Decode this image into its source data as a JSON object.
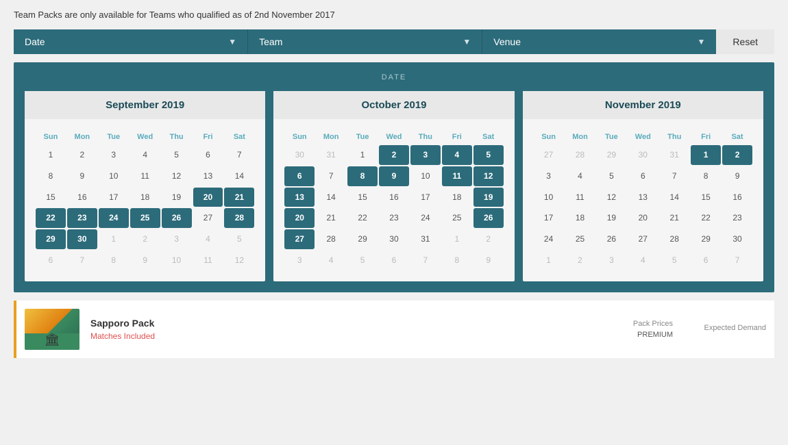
{
  "notice": "Team Packs are only available for Teams who qualified as of 2nd November 2017",
  "filters": {
    "date_label": "Date",
    "team_label": "Team",
    "venue_label": "Venue",
    "reset_label": "Reset"
  },
  "calendar_section": {
    "title": "DATE",
    "months": [
      {
        "name": "September 2019",
        "days_in_month": 30,
        "start_day": 0,
        "rows": [
          [
            "",
            "1",
            "2",
            "3",
            "4",
            "5",
            "6",
            "7"
          ],
          [
            "",
            "8",
            "9",
            "10",
            "11",
            "12",
            "13",
            "14"
          ],
          [
            "",
            "15",
            "16",
            "17",
            "18",
            "19",
            "20",
            "21"
          ],
          [
            "",
            "22",
            "23",
            "24",
            "25",
            "26",
            "27",
            "28"
          ],
          [
            "",
            "29",
            "30",
            "1",
            "2",
            "3",
            "4",
            "5"
          ],
          [
            "",
            "6",
            "7",
            "8",
            "9",
            "10",
            "11",
            "12"
          ]
        ],
        "highlighted": [
          "20",
          "21",
          "22",
          "23",
          "24",
          "25",
          "26",
          "28",
          "29",
          "30"
        ]
      },
      {
        "name": "October 2019",
        "rows": [
          [
            "30",
            "31",
            "1",
            "2",
            "3",
            "4",
            "5"
          ],
          [
            "6",
            "7",
            "8",
            "9",
            "10",
            "11",
            "12"
          ],
          [
            "13",
            "14",
            "15",
            "16",
            "17",
            "18",
            "19"
          ],
          [
            "20",
            "21",
            "22",
            "23",
            "24",
            "25",
            "26"
          ],
          [
            "27",
            "28",
            "29",
            "30",
            "31",
            "1",
            "2"
          ],
          [
            "3",
            "4",
            "5",
            "6",
            "7",
            "8",
            "9"
          ]
        ],
        "highlighted_positions": {
          "r0": [
            3,
            4,
            5,
            6
          ],
          "r1": [
            0,
            2,
            3,
            5,
            6
          ],
          "r2": [
            0,
            6
          ],
          "r3": [
            0,
            6
          ],
          "r4": [
            0
          ]
        }
      },
      {
        "name": "November 2019",
        "rows": [
          [
            "27",
            "28",
            "29",
            "30",
            "31",
            "1",
            "2"
          ],
          [
            "3",
            "4",
            "5",
            "6",
            "7",
            "8",
            "9"
          ],
          [
            "10",
            "11",
            "12",
            "13",
            "14",
            "15",
            "16"
          ],
          [
            "17",
            "18",
            "19",
            "20",
            "21",
            "22",
            "23"
          ],
          [
            "24",
            "25",
            "26",
            "27",
            "28",
            "29",
            "30"
          ],
          [
            "1",
            "2",
            "3",
            "4",
            "5",
            "6",
            "7"
          ]
        ],
        "highlighted_positions": {
          "r0": [
            5,
            6
          ]
        }
      }
    ],
    "day_labels": [
      "Sun",
      "Mon",
      "Tue",
      "Wed",
      "Thu",
      "Fri",
      "Sat"
    ]
  },
  "pack_card": {
    "title": "Sapporo Pack",
    "subtitle": "Matches Included",
    "prices_label": "Pack Prices",
    "premium_label": "PREMIUM",
    "expected_demand_label": "Expected Demand"
  }
}
